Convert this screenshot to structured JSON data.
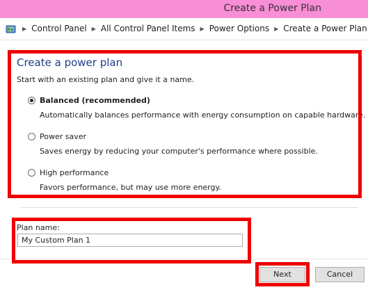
{
  "window": {
    "title": "Create a Power Plan",
    "accent_color": "#f88fd6"
  },
  "address_bar": {
    "icon": "control-panel-icon",
    "breadcrumbs": [
      "Control Panel",
      "All Control Panel Items",
      "Power Options",
      "Create a Power Plan"
    ]
  },
  "main": {
    "heading": "Create a power plan",
    "intro": "Start with an existing plan and give it a name.",
    "plans": [
      {
        "label": "Balanced (recommended)",
        "description": "Automatically balances performance with energy consumption on capable hardware.",
        "selected": true
      },
      {
        "label": "Power saver",
        "description": "Saves energy by reducing your computer's performance where possible.",
        "selected": false
      },
      {
        "label": "High performance",
        "description": "Favors performance, but may use more energy.",
        "selected": false
      }
    ],
    "plan_name": {
      "label": "Plan name:",
      "value": "My Custom Plan 1"
    }
  },
  "footer": {
    "next_label": "Next",
    "cancel_label": "Cancel"
  },
  "highlight_color": "#ee0000"
}
